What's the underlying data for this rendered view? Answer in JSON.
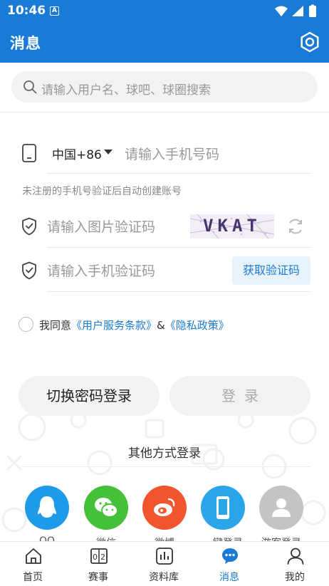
{
  "status_bar": {
    "time": "10:46",
    "notification_glyph": "A"
  },
  "header": {
    "title": "消息",
    "settings_icon": "settings-hexagon-icon"
  },
  "search": {
    "placeholder": "请输入用户名、球吧、球圈搜索"
  },
  "login_form": {
    "country_code": "中国+86",
    "phone_placeholder": "请输入手机号码",
    "hint": "未注册的手机号验证后自动创建账号",
    "captcha_placeholder": "请输入图片验证码",
    "captcha_image_text": "VKAT",
    "sms_placeholder": "请输入手机验证码",
    "get_code_label": "获取验证码"
  },
  "agreement": {
    "prefix": "我同意",
    "terms_link": "《用户服务条款》",
    "amp": "&",
    "privacy_link": "《隐私政策》"
  },
  "buttons": {
    "switch_password_login": "切换密码登录",
    "login": "登录"
  },
  "other_login": {
    "title": "其他方式登录",
    "options": [
      {
        "label": "QQ",
        "icon": "qq-icon",
        "color": "#1e9be8"
      },
      {
        "label": "微信",
        "icon": "wechat-icon",
        "color": "#44c138"
      },
      {
        "label": "微博",
        "icon": "weibo-icon",
        "color": "#f0552d"
      },
      {
        "label": "一键登录",
        "icon": "phone-login-icon",
        "color": "#2aa5ea"
      },
      {
        "label": "游客登录",
        "icon": "guest-icon",
        "color": "#c4c4c4"
      }
    ]
  },
  "bottom_nav": {
    "active": "消息",
    "items": [
      {
        "label": "首页",
        "icon": "home-icon"
      },
      {
        "label": "赛事",
        "icon": "scoreboard-icon"
      },
      {
        "label": "资料库",
        "icon": "stats-chart-icon"
      },
      {
        "label": "消息",
        "icon": "message-bubble-icon"
      },
      {
        "label": "我的",
        "icon": "user-profile-icon"
      }
    ]
  },
  "colors": {
    "brand": "#1a7bd6",
    "link": "#1a7bd6",
    "muted": "#999999"
  }
}
